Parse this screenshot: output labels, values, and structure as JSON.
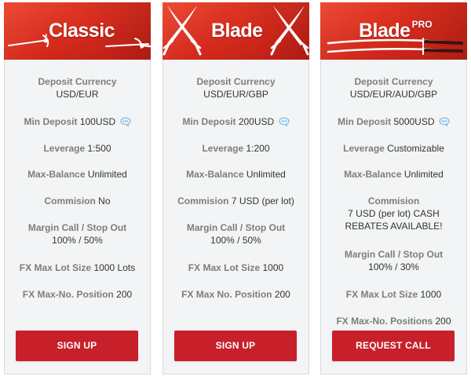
{
  "colors": {
    "header_red": "#d42a1c",
    "button_red": "#c8202b",
    "panel_bg": "#f2f4f5",
    "label_gray": "#7d7d7d",
    "value_dark": "#333333",
    "info_icon_blue": "#6fb0e0"
  },
  "plans": [
    {
      "title": "Classic",
      "header_icon": "rapier-swords-icon",
      "deposit_currency": {
        "label": "Deposit Currency",
        "value": "USD/EUR"
      },
      "min_deposit": {
        "label": "Min Deposit",
        "value": "100USD",
        "icon": "chat-info-icon"
      },
      "leverage": {
        "label": "Leverage",
        "value": "1:500"
      },
      "max_balance": {
        "label": "Max-Balance",
        "value": "Unlimited"
      },
      "commission": {
        "label": "Commision",
        "value": "No"
      },
      "margin_call": {
        "label": "Margin Call / Stop Out",
        "value": "100% / 50%"
      },
      "fx_max_lot": {
        "label": "FX Max Lot Size",
        "value": "1000 Lots"
      },
      "fx_max_positions": {
        "label": "FX Max-No. Position",
        "value": "200"
      },
      "button_label": "SIGN UP"
    },
    {
      "title": "Blade",
      "header_icon": "crossed-sabres-icon",
      "deposit_currency": {
        "label": "Deposit Currency",
        "value": "USD/EUR/GBP"
      },
      "min_deposit": {
        "label": "Min Deposit",
        "value": "200USD",
        "icon": "chat-info-icon"
      },
      "leverage": {
        "label": "Leverage",
        "value": "1:200"
      },
      "max_balance": {
        "label": "Max-Balance",
        "value": "Unlimited"
      },
      "commission": {
        "label": "Commision",
        "value": "7 USD (per lot)"
      },
      "margin_call": {
        "label": "Margin Call / Stop Out",
        "value": "100% / 50%"
      },
      "fx_max_lot": {
        "label": "FX Max Lot Size",
        "value": "1000"
      },
      "fx_max_positions": {
        "label": "FX Max No. Position",
        "value": "200"
      },
      "button_label": "SIGN UP"
    },
    {
      "title": "Blade",
      "title_sup": "PRO",
      "header_icon": "katana-swords-icon",
      "deposit_currency": {
        "label": "Deposit Currency",
        "value": "USD/EUR/AUD/GBP"
      },
      "min_deposit": {
        "label": "Min Deposit",
        "value": "5000USD",
        "icon": "chat-info-icon"
      },
      "leverage": {
        "label": "Leverage",
        "value": "Customizable"
      },
      "max_balance": {
        "label": "Max-Balance",
        "value": "Unlimited"
      },
      "commission": {
        "label": "Commision",
        "value_line1": "7 USD (per lot) CASH",
        "value_line2": "REBATES AVAILABLE!"
      },
      "margin_call": {
        "label": "Margin Call / Stop Out",
        "value": "100% / 30%"
      },
      "fx_max_lot": {
        "label": "FX Max Lot Size",
        "value": "1000"
      },
      "fx_max_positions": {
        "label": "FX Max-No. Positions",
        "value": "200"
      },
      "button_label": "REQUEST CALL"
    }
  ]
}
